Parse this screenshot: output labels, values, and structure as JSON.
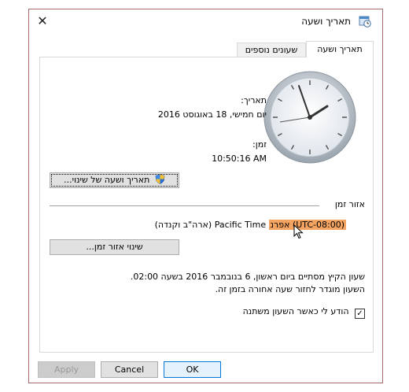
{
  "window": {
    "title": "תאריך ושעה",
    "close_glyph": "✕",
    "title_icon": "clock-calendar-icon"
  },
  "tabs": [
    {
      "label": "תאריך ושעה",
      "active": true
    },
    {
      "label": "שעונים נוספים",
      "active": false
    }
  ],
  "date_section": {
    "date_label": "תאריך:",
    "date_value": "יום חמישי, 18 באוגוסט 2016",
    "time_label": "זמן:",
    "time_value": "10:50:16 AM",
    "change_datetime_button": "תאריך ושעה של שינוי..."
  },
  "timezone_section": {
    "header": "אזור זמן",
    "timezone_value_highlighted": "(UTC-08:00) אפרנ",
    "timezone_value_rest": "Pacific Time (ארה\"ב וקנדה)",
    "change_timezone_button": "שינוי אזור זמן...",
    "dst_line1": "שעון הקיץ מסתיים ביום ראשון, 6 בנובמבר 2016 בשעה 02:00.",
    "dst_line2": "השעון מוגדר לחזור שעה אחורה בזמן זה.",
    "notify_checkbox_label": "הודע לי כאשר השעון משתנה",
    "notify_checked": true
  },
  "buttons": {
    "ok": "OK",
    "cancel": "Cancel",
    "apply": "Apply"
  },
  "colors": {
    "highlight": "#f4a460",
    "accent": "#0078d7"
  }
}
